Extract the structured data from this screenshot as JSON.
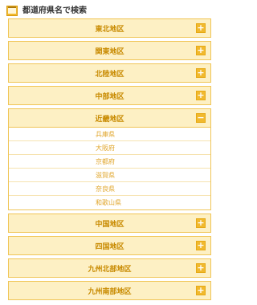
{
  "header": {
    "title": "都道府県名で検索",
    "icon": "map-icon"
  },
  "colors": {
    "accent": "#f1b92e",
    "panel_bg": "#fdf0c4",
    "panel_border": "#f0c556",
    "label": "#c88a00",
    "link": "#e0a52a"
  },
  "regions": [
    {
      "label": "東北地区",
      "toggle": "+"
    },
    {
      "label": "関東地区",
      "toggle": "+"
    },
    {
      "label": "北陸地区",
      "toggle": "+"
    },
    {
      "label": "中部地区",
      "toggle": "+"
    },
    {
      "label": "近畿地区",
      "toggle": "−"
    },
    {
      "label": "中国地区",
      "toggle": "+"
    },
    {
      "label": "四国地区",
      "toggle": "+"
    },
    {
      "label": "九州北部地区",
      "toggle": "+"
    },
    {
      "label": "九州南部地区",
      "toggle": "+"
    }
  ],
  "kinki_prefectures": [
    "兵庫県",
    "大阪府",
    "京都府",
    "滋賀県",
    "奈良県",
    "和歌山県"
  ]
}
